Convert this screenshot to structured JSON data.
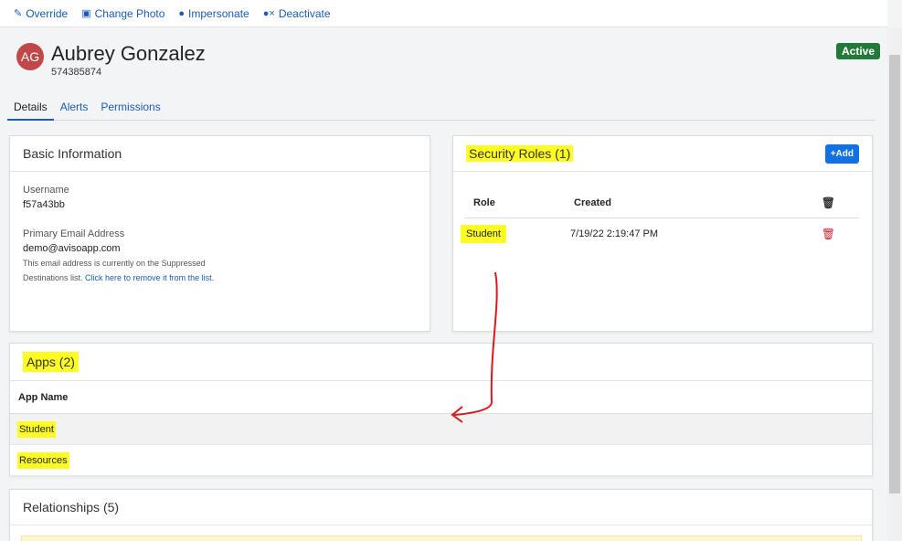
{
  "toolbar": {
    "override": "Override",
    "change_photo": "Change Photo",
    "impersonate": "Impersonate",
    "deactivate": "Deactivate"
  },
  "user": {
    "initials": "AG",
    "name": "Aubrey Gonzalez",
    "id": "574385874",
    "status": "Active"
  },
  "tabs": [
    "Details",
    "Alerts",
    "Permissions"
  ],
  "basic_info": {
    "title": "Basic Information",
    "username_label": "Username",
    "username": "f57a43bb",
    "email_label": "Primary Email Address",
    "email": "demo@avisoapp.com",
    "note_text": "This email address is currently on the Suppressed Destinations list.",
    "note_link": "Click here to remove it from the list."
  },
  "security_roles": {
    "title": "Security Roles (1)",
    "add_label": "Add",
    "col_role": "Role",
    "col_created": "Created",
    "rows": [
      {
        "role": "Student",
        "created": "7/19/22 2:19:47 PM"
      }
    ]
  },
  "apps": {
    "title": "Apps (2)",
    "col_name": "App Name",
    "rows": [
      "Student",
      "Resources"
    ]
  },
  "relationships": {
    "title": "Relationships (5)"
  },
  "colors": {
    "link": "#1a5bb8",
    "active_badge": "#217a3a",
    "add_button": "#1170e4",
    "highlight": "#fdfd24",
    "annotation_arrow": "#d61c1c",
    "delete_red": "#c82333"
  }
}
